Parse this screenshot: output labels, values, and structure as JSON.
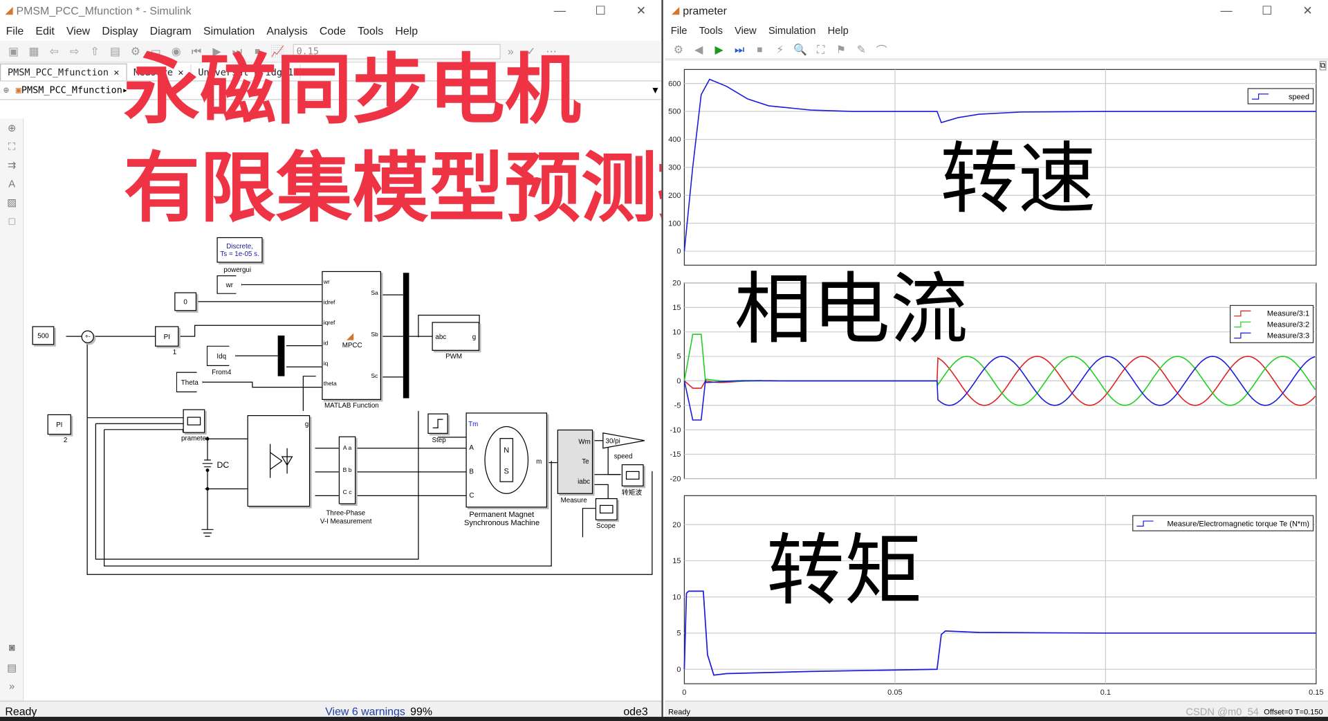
{
  "sim": {
    "title": "PMSM_PCC_Mfunction * - Simulink",
    "menu": [
      "File",
      "Edit",
      "View",
      "Display",
      "Diagram",
      "Simulation",
      "Analysis",
      "Code",
      "Tools",
      "Help"
    ],
    "stoptime": "0.15",
    "tabs": [
      "PMSM_PCC_Mfunction",
      "Measure",
      "Universal Bridge1"
    ],
    "breadcrumb": "PMSM_PCC_Mfunction",
    "status_ready": "Ready",
    "status_warnings": "View 6 warnings",
    "status_zoom": "99%",
    "status_solver": "ode3",
    "blocks": {
      "powergui_line1": "Discrete,",
      "powergui_line2": "Ts = 1e-05 s.",
      "powergui": "powergui",
      "wr": "wr",
      "zero": "0",
      "five_hundred": "500",
      "pi1": "PI",
      "pi1_num": "1",
      "pi2": "PI",
      "pi2_num": "2",
      "idq": "Idq",
      "from4": "From4",
      "theta": "Theta",
      "mpcc": "MPCC",
      "matlab_fn": "MATLAB Function",
      "mpcc_in": [
        "wr",
        "idref",
        "iqref",
        "id",
        "iq",
        "theta"
      ],
      "mpcc_out": [
        "Sa",
        "Sb",
        "Sc"
      ],
      "pwm": "PWM",
      "pwm_in": "abc",
      "pwm_out": "g",
      "prameter": "prameter",
      "dc": "DC",
      "g": "g",
      "three_phase_1": "Three-Phase",
      "three_phase_2": "V-I Measurement",
      "abc_ports": [
        "A a",
        "B b",
        "C c"
      ],
      "step": "Step",
      "tm": "Tm",
      "m": "m",
      "pmsm_1": "Permanent Magnet",
      "pmsm_2": "Synchronous Machine",
      "measure": "Measure",
      "wm": "Wm",
      "te": "Te",
      "iabc": "iabc",
      "gain": "30/pi",
      "speed": "speed",
      "torque_scope": "转矩波",
      "scope": "Scope",
      "abc_in": [
        "A",
        "B",
        "C"
      ]
    }
  },
  "overlay": {
    "line1": "永磁同步电机",
    "line2": "有限集模型预测控制"
  },
  "scope": {
    "title": "prameter",
    "menu": [
      "File",
      "Tools",
      "View",
      "Simulation",
      "Help"
    ],
    "status": "Ready",
    "status_right": "Offset=0  T=0.150",
    "watermark": "CSDN @m0_54",
    "labels": {
      "speed": "转速",
      "current": "相电流",
      "torque": "转矩"
    },
    "colors": {
      "blue": "#1a1adb",
      "red": "#e02020",
      "green": "#1fd01f"
    }
  },
  "chart_data": [
    {
      "type": "line",
      "ylim": [
        -50,
        650
      ],
      "xlim": [
        0,
        0.15
      ],
      "yticks": [
        "600",
        "500",
        "400",
        "300",
        "200",
        "100",
        "0"
      ],
      "series": [
        {
          "name": "speed",
          "x": [
            0,
            0.002,
            0.004,
            0.006,
            0.01,
            0.015,
            0.02,
            0.03,
            0.04,
            0.06,
            0.061,
            0.065,
            0.07,
            0.08,
            0.1,
            0.15
          ],
          "values": [
            0,
            300,
            560,
            615,
            590,
            545,
            520,
            505,
            500,
            500,
            460,
            478,
            490,
            498,
            500,
            500
          ]
        }
      ]
    },
    {
      "type": "line",
      "ylim": [
        -20,
        20
      ],
      "xlim": [
        0,
        0.15
      ],
      "yticks": [
        "20",
        "15",
        "10",
        "5",
        "0",
        "-5",
        "-10",
        "-15",
        "-20"
      ],
      "series": [
        {
          "name": "Measure/3:1"
        },
        {
          "name": "Measure/3:2"
        },
        {
          "name": "Measure/3:3"
        }
      ]
    },
    {
      "type": "line",
      "ylim": [
        -2,
        24
      ],
      "xlim": [
        0,
        0.15
      ],
      "yticks": [
        "20",
        "15",
        "10",
        "5",
        "0"
      ],
      "xticks": [
        "0",
        "0.05",
        "0.1",
        "0.15"
      ],
      "series": [
        {
          "name": "Measure/Electromagnetic torque Te (N*m)",
          "x": [
            0,
            0.0005,
            0.001,
            0.0045,
            0.0055,
            0.007,
            0.01,
            0.03,
            0.06,
            0.061,
            0.062,
            0.07,
            0.1,
            0.15
          ],
          "values": [
            0,
            10.5,
            10.8,
            10.8,
            2,
            -0.8,
            -0.6,
            -0.3,
            0,
            4.8,
            5.3,
            5.1,
            5,
            5
          ]
        }
      ]
    }
  ]
}
